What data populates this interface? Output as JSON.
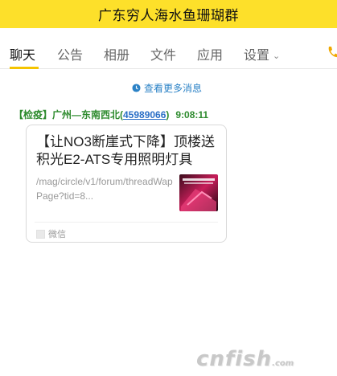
{
  "window": {
    "title": "广东穷人海水鱼珊瑚群"
  },
  "tabs": [
    {
      "label": "聊天",
      "active": true
    },
    {
      "label": "公告"
    },
    {
      "label": "相册"
    },
    {
      "label": "文件"
    },
    {
      "label": "应用"
    },
    {
      "label": "设置"
    }
  ],
  "chat": {
    "more_messages_label": "查看更多消息",
    "message": {
      "sender_prefix": "【检疫】广州—东南西北(",
      "sender_qq": "45989066",
      "sender_suffix": ")",
      "time": "9:08:11",
      "card": {
        "title": "【让NO3断崖式下降】顶楼送积光E2-ATS专用照明灯具",
        "description": "/mag/circle/v1/forum/threadWapPage?tid=8...",
        "source_label": "微信"
      }
    }
  },
  "watermark": {
    "text": "cnfish",
    "suffix": ".com"
  },
  "colors": {
    "titlebar_bg": "#fde02a",
    "link": "#2b82c6",
    "sender": "#2e8b2e",
    "tab_underline": "#f5c400"
  }
}
